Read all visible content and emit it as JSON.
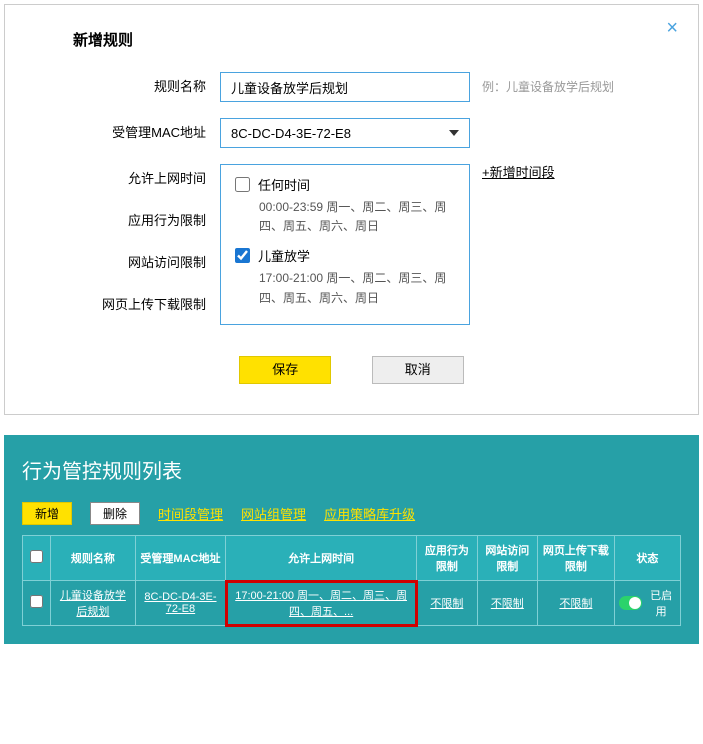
{
  "modal": {
    "title": "新增规则",
    "labels": {
      "ruleName": "规则名称",
      "macAddr": "受管理MAC地址",
      "allowTime": "允许上网时间",
      "appLimit": "应用行为限制",
      "siteLimit": "网站访问限制",
      "pageLimit": "网页上传下载限制"
    },
    "ruleNameValue": "儿童设备放学后规划",
    "ruleNameHint": "例：儿童设备放学后规划",
    "macValue": "8C-DC-D4-3E-72-E8",
    "addSlot": "+新增时间段",
    "timeSlots": [
      {
        "checked": false,
        "name": "任何时间",
        "detail": "00:00-23:59 周一、周二、周三、周四、周五、周六、周日"
      },
      {
        "checked": true,
        "name": "儿童放学",
        "detail": "17:00-21:00 周一、周二、周三、周四、周五、周六、周日"
      }
    ],
    "save": "保存",
    "cancel": "取消"
  },
  "section": {
    "title": "行为管控规则列表",
    "toolbar": {
      "add": "新增",
      "del": "删除",
      "timeMgmt": "时间段管理",
      "siteMgmt": "网站组管理",
      "appUpgrade": "应用策略库升级"
    },
    "columns": [
      "规则名称",
      "受管理MAC地址",
      "允许上网时间",
      "应用行为限制",
      "网站访问限制",
      "网页上传下载限制",
      "状态"
    ],
    "row": {
      "name": "儿童设备放学后规划",
      "mac": "8C-DC-D4-3E-72-E8",
      "time": "17:00-21:00 周一、周二、周三、周四、周五、...",
      "app": "不限制",
      "site": "不限制",
      "page": "不限制",
      "status": "已启用"
    }
  }
}
